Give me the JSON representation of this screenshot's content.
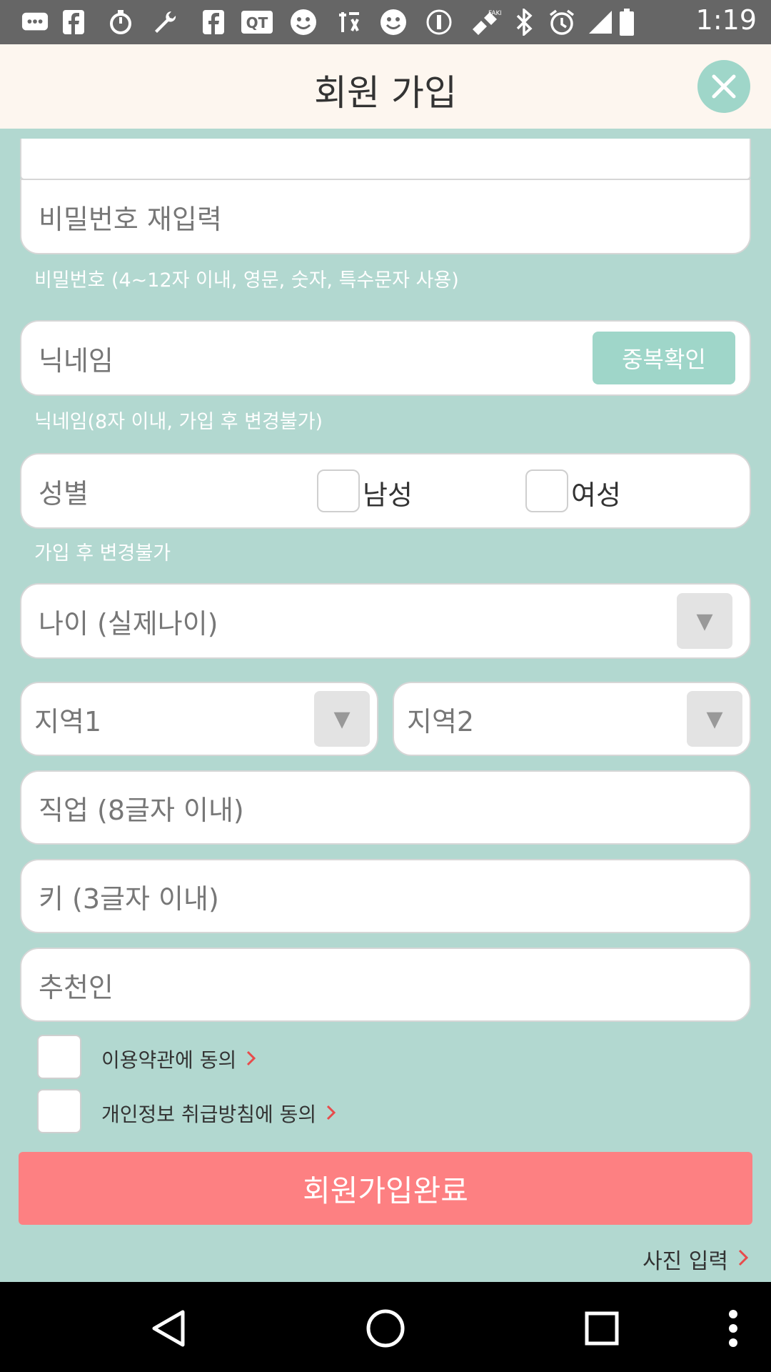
{
  "status_bar": {
    "time": "1:19",
    "icons": [
      "messaging-icon",
      "facebook-icon",
      "timer-icon",
      "wrench-icon",
      "facebook-icon",
      "qt-icon",
      "smiley-icon",
      "app-icon",
      "smiley-icon",
      "vibrate-icon",
      "fake-gps-icon",
      "bluetooth-icon",
      "alarm-icon",
      "signal-icon",
      "battery-icon"
    ]
  },
  "header": {
    "title": "회원 가입"
  },
  "form": {
    "password_confirm_placeholder": "비밀번호 재입력",
    "password_hint": "비밀번호 (4~12자 이내, 영문, 숫자, 특수문자 사용)",
    "nickname_placeholder": "닉네임",
    "duplicate_check_label": "중복확인",
    "nickname_hint": "닉네임(8자 이내, 가입 후 변경불가)",
    "gender_label": "성별",
    "male_label": "남성",
    "female_label": "여성",
    "gender_hint": "가입 후 변경불가",
    "age_placeholder": "나이 (실제나이)",
    "region1_placeholder": "지역1",
    "region2_placeholder": "지역2",
    "job_placeholder": "직업 (8글자 이내)",
    "height_placeholder": "키 (3글자 이내)",
    "referrer_placeholder": "추천인"
  },
  "agreements": {
    "terms_label": "이용약관에 동의",
    "privacy_label": "개인정보 취급방침에 동의"
  },
  "submit_label": "회원가입완료",
  "photo_link_label": "사진 입력",
  "colors": {
    "background": "#b2d8d0",
    "header": "#fdf6ef",
    "accent": "#9fd6c9",
    "submit": "#fd8082",
    "arrow": "#e84b4b"
  }
}
